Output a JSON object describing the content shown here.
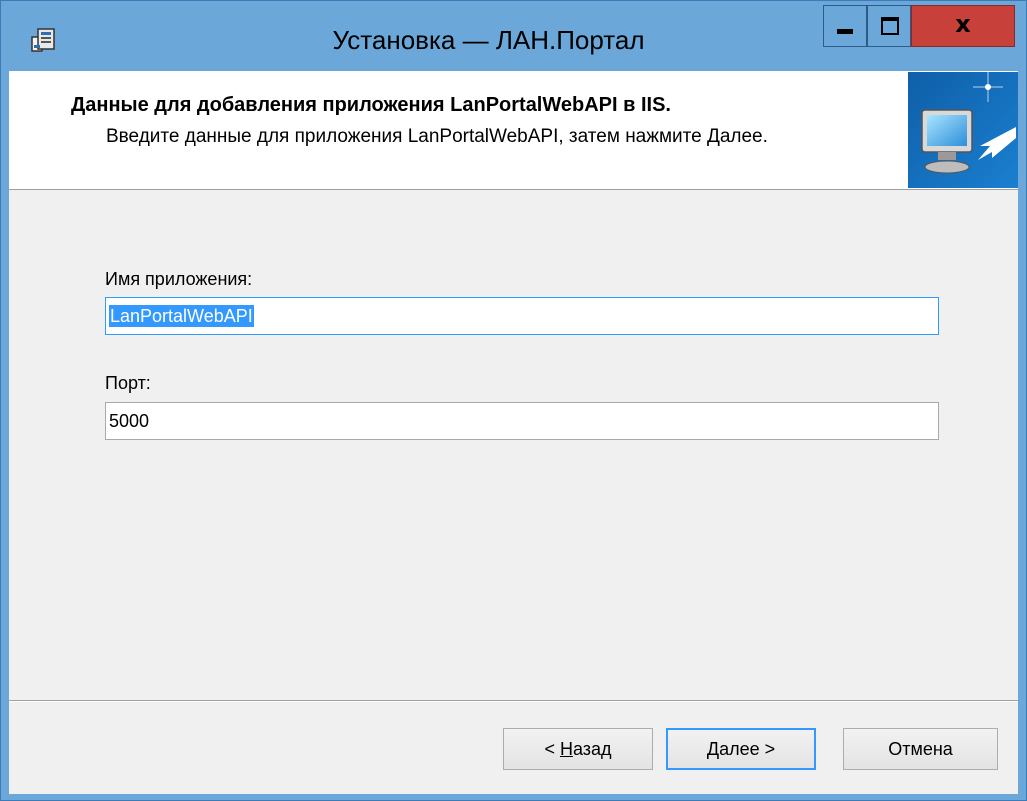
{
  "window": {
    "title": "Установка — ЛАН.Портал",
    "title_bar_color": "#6ba7d8",
    "close_button_color": "#c7413a"
  },
  "header": {
    "title": "Данные для добавления приложения LanPortalWebAPI в IIS.",
    "subtitle": "Введите данные для приложения LanPortalWebAPI, затем нажмите Далее."
  },
  "form": {
    "app_name_label": "Имя приложения:",
    "app_name_value": "LanPortalWebAPI",
    "port_label": "Порт:",
    "port_value": "5000"
  },
  "buttons": {
    "back_prefix": "< ",
    "back_hotkey": "Н",
    "back_rest": "азад",
    "next_hotkey": "Д",
    "next_rest": "алее >",
    "cancel": "Отмена"
  },
  "icons": {
    "app_icon": "installer-icon",
    "banner_icon": "computer-install-icon",
    "minimize": "minimize-icon",
    "maximize": "maximize-icon",
    "close": "close-icon"
  },
  "colors": {
    "selection": "#3399ff",
    "client_background": "#f0f0f0"
  }
}
